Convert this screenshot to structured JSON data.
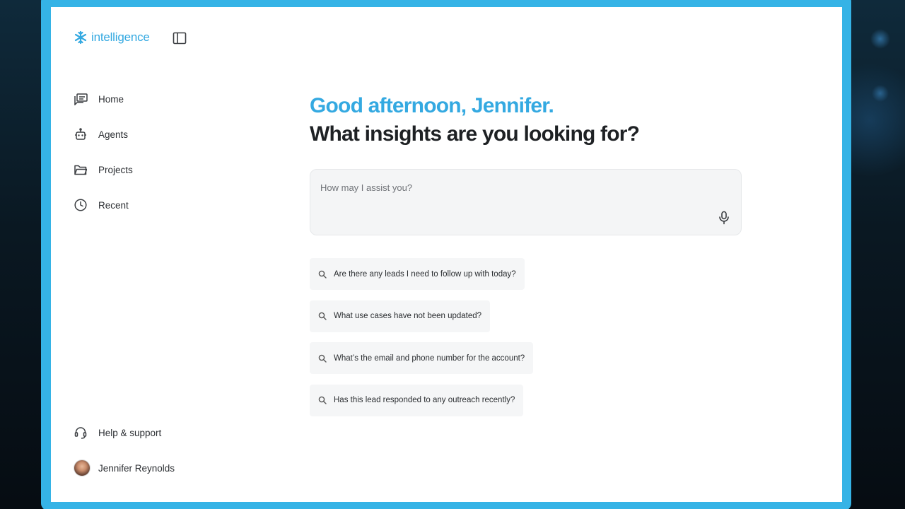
{
  "app": {
    "brand": "intelligence",
    "accent": "#34a9e1"
  },
  "sidebar": {
    "items": [
      {
        "label": "Home",
        "icon": "home-chat-icon"
      },
      {
        "label": "Agents",
        "icon": "robot-icon"
      },
      {
        "label": "Projects",
        "icon": "folder-icon"
      },
      {
        "label": "Recent",
        "icon": "clock-icon"
      }
    ],
    "help_label": "Help & support",
    "user_name": "Jennifer Reynolds"
  },
  "main": {
    "greeting": "Good afternoon, Jennifer.",
    "question": "What insights are you looking for?",
    "prompt_placeholder": "How may I assist you?",
    "suggestions": [
      "Are there any leads I need to follow up with today?",
      "What use cases have not been updated?",
      "What’s the email and phone number for the account?",
      "Has this lead responded to any outreach recently?"
    ]
  }
}
